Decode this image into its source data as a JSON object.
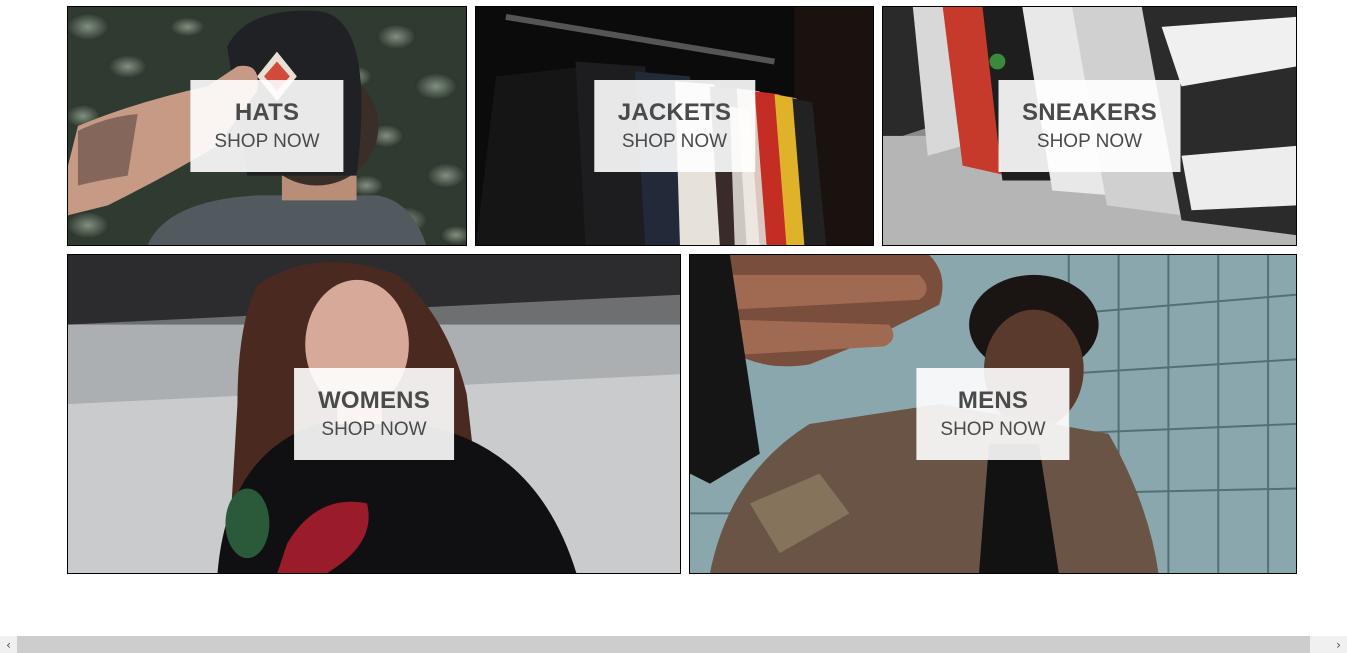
{
  "directory": {
    "hats": {
      "title": "HATS",
      "cta": "SHOP NOW",
      "image": "hat-photo"
    },
    "jackets": {
      "title": "JACKETS",
      "cta": "SHOP NOW",
      "image": "jacket-rack-photo"
    },
    "sneakers": {
      "title": "SNEAKERS",
      "cta": "SHOP NOW",
      "image": "sneakers-photo"
    },
    "womens": {
      "title": "WOMENS",
      "cta": "SHOP NOW",
      "image": "woman-portrait-photo"
    },
    "mens": {
      "title": "MENS",
      "cta": "SHOP NOW",
      "image": "man-portrait-photo"
    }
  },
  "scrollbar": {
    "left_arrow": "‹",
    "right_arrow": "›"
  },
  "colors": {
    "label_bg": "#ffffffe6",
    "label_text": "#4a4a4a",
    "border": "#000000"
  }
}
